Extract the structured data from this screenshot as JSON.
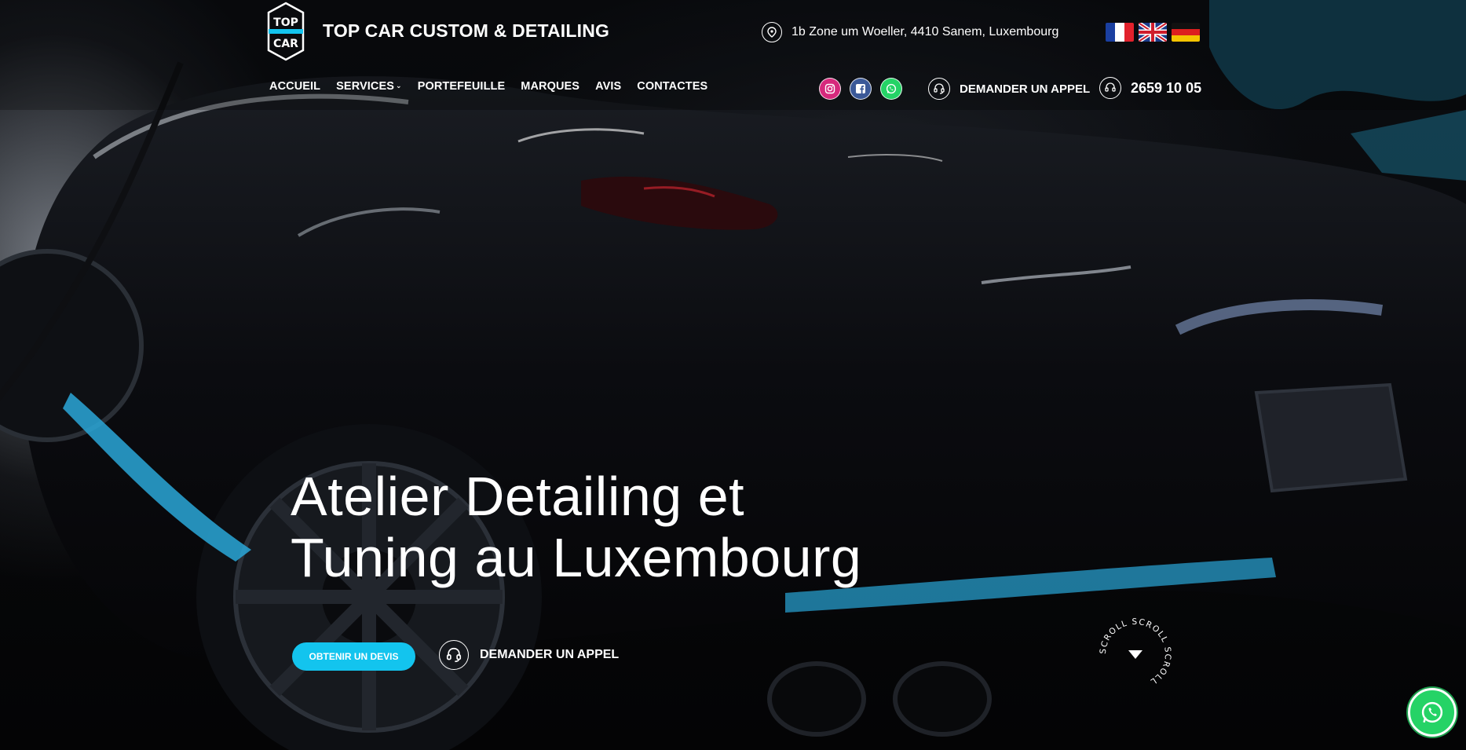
{
  "header": {
    "brand": "TOP CAR CUSTOM & DETAILING",
    "logo_text_top": "TOP",
    "logo_text_bottom": "CAR",
    "address": "1b Zone um Woeller, 4410 Sanem, Luxembourg",
    "languages": [
      "fr",
      "en",
      "de"
    ],
    "nav": [
      {
        "label": "ACCUEIL"
      },
      {
        "label": "SERVICES",
        "has_dropdown": true
      },
      {
        "label": "PORTEFEUILLE"
      },
      {
        "label": "MARQUES"
      },
      {
        "label": "AVIS"
      },
      {
        "label": "CONTACTES"
      }
    ],
    "socials": [
      "instagram-icon",
      "facebook-icon",
      "whatsapp-icon"
    ],
    "callback_label": "DEMANDER UN APPEL",
    "phone": "2659 10 05"
  },
  "hero": {
    "headline_line1": "Atelier Detailing et",
    "headline_line2": "Tuning au Luxembourg",
    "cta_primary": "OBTENIR UN DEVIS",
    "cta_secondary": "DEMANDER UN APPEL",
    "scroll_text": "SCROLL SCROLL SCROLL "
  },
  "colors": {
    "accent": "#13c4ee",
    "whatsapp": "#25d366",
    "instagram": "#d6297c",
    "facebook": "#3b5998"
  }
}
